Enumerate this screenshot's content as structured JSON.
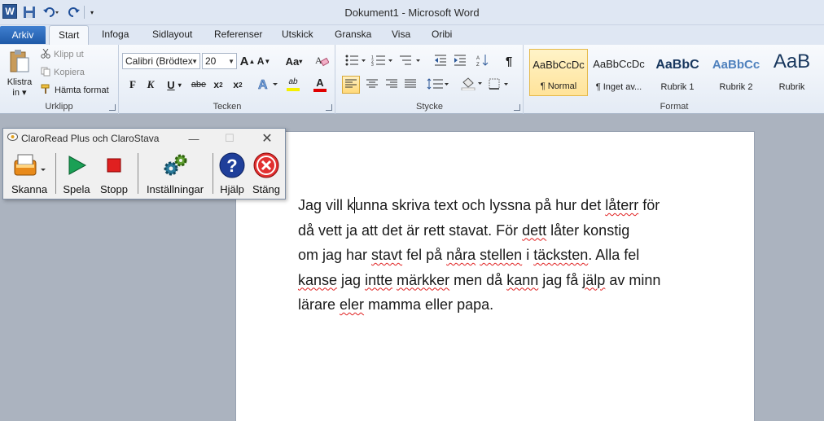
{
  "window": {
    "title": "Dokument1 - Microsoft Word",
    "app_icon": "word-logo-icon",
    "app_letter": "W"
  },
  "quick_access": {
    "save": "save-icon",
    "undo": "undo-icon",
    "redo": "redo-icon",
    "customize": "customize-qat-icon"
  },
  "tabs": [
    "Arkiv",
    "Start",
    "Infoga",
    "Sidlayout",
    "Referenser",
    "Utskick",
    "Granska",
    "Visa",
    "Oribi"
  ],
  "active_tab": "Start",
  "ribbon": {
    "clipboard": {
      "label": "Urklipp",
      "paste_line1": "Klistra",
      "paste_line2": "in",
      "cut": "Klipp ut",
      "copy": "Kopiera",
      "format_painter": "Hämta format"
    },
    "font": {
      "label": "Tecken",
      "font_name": "Calibri (Brödtex",
      "font_size": "20",
      "grow": "A",
      "shrink": "A",
      "change_case": "Aa",
      "bold": "F",
      "italic": "K",
      "underline": "U",
      "strike": "abe",
      "subscript": "x",
      "superscript": "x",
      "sub_mark": "2",
      "sup_mark": "2",
      "font_color": "A",
      "highlight": "ab"
    },
    "paragraph": {
      "label": "Stycke"
    },
    "styles": {
      "label": "Format",
      "items": [
        {
          "sample": "AaBbCcDc",
          "name": "¶ Normal"
        },
        {
          "sample": "AaBbCcDc",
          "name": "¶ Inget av..."
        },
        {
          "sample": "AaBbC",
          "name": "Rubrik 1"
        },
        {
          "sample": "AaBbCc",
          "name": "Rubrik 2"
        },
        {
          "sample": "AaB",
          "name": "Rubrik"
        }
      ]
    }
  },
  "document": {
    "lines": [
      [
        {
          "t": "Jag vill k",
          "s": false
        },
        {
          "t": "|caret|",
          "s": false
        },
        {
          "t": "unna skriva text och lyssna på hur det ",
          "s": false
        },
        {
          "t": "låterr",
          "s": true
        },
        {
          "t": " för",
          "s": false
        }
      ],
      [
        {
          "t": "då vett ja att det är rett stavat. För ",
          "s": false
        },
        {
          "t": "dett",
          "s": true
        },
        {
          "t": " låter konstig",
          "s": false
        }
      ],
      [
        {
          "t": "om jag har ",
          "s": false
        },
        {
          "t": "stavt",
          "s": true
        },
        {
          "t": " fel på ",
          "s": false
        },
        {
          "t": "nåra",
          "s": true
        },
        {
          "t": " ",
          "s": false
        },
        {
          "t": "stellen",
          "s": true
        },
        {
          "t": " i ",
          "s": false
        },
        {
          "t": "täcksten",
          "s": true
        },
        {
          "t": ". Alla fel",
          "s": false
        }
      ],
      [
        {
          "t": "kanse",
          "s": true
        },
        {
          "t": " jag ",
          "s": false
        },
        {
          "t": "intte",
          "s": true
        },
        {
          "t": " ",
          "s": false
        },
        {
          "t": "märkker",
          "s": true
        },
        {
          "t": " men då ",
          "s": false
        },
        {
          "t": "kann",
          "s": true
        },
        {
          "t": " jag få ",
          "s": false
        },
        {
          "t": "jälp",
          "s": true
        },
        {
          "t": " av minn",
          "s": false
        }
      ],
      [
        {
          "t": "lärare ",
          "s": false
        },
        {
          "t": "eler",
          "s": true
        },
        {
          "t": " mamma eller papa.",
          "s": false
        }
      ]
    ]
  },
  "claro": {
    "title": "ClaroRead Plus och ClaroStava",
    "buttons": [
      {
        "label": "Skanna",
        "icon": "scan-icon"
      },
      {
        "label": "Spela",
        "icon": "play-icon"
      },
      {
        "label": "Stopp",
        "icon": "stop-icon"
      },
      {
        "label": "Inställningar",
        "icon": "settings-gears-icon"
      },
      {
        "label": "Hjälp",
        "icon": "help-icon"
      },
      {
        "label": "Stäng",
        "icon": "close-circle-icon"
      }
    ]
  },
  "colors": {
    "accent": "#2b5797",
    "file_tab": "#2a64b6",
    "spell_underline": "#e02020",
    "selected_style": "#ffe39a"
  }
}
